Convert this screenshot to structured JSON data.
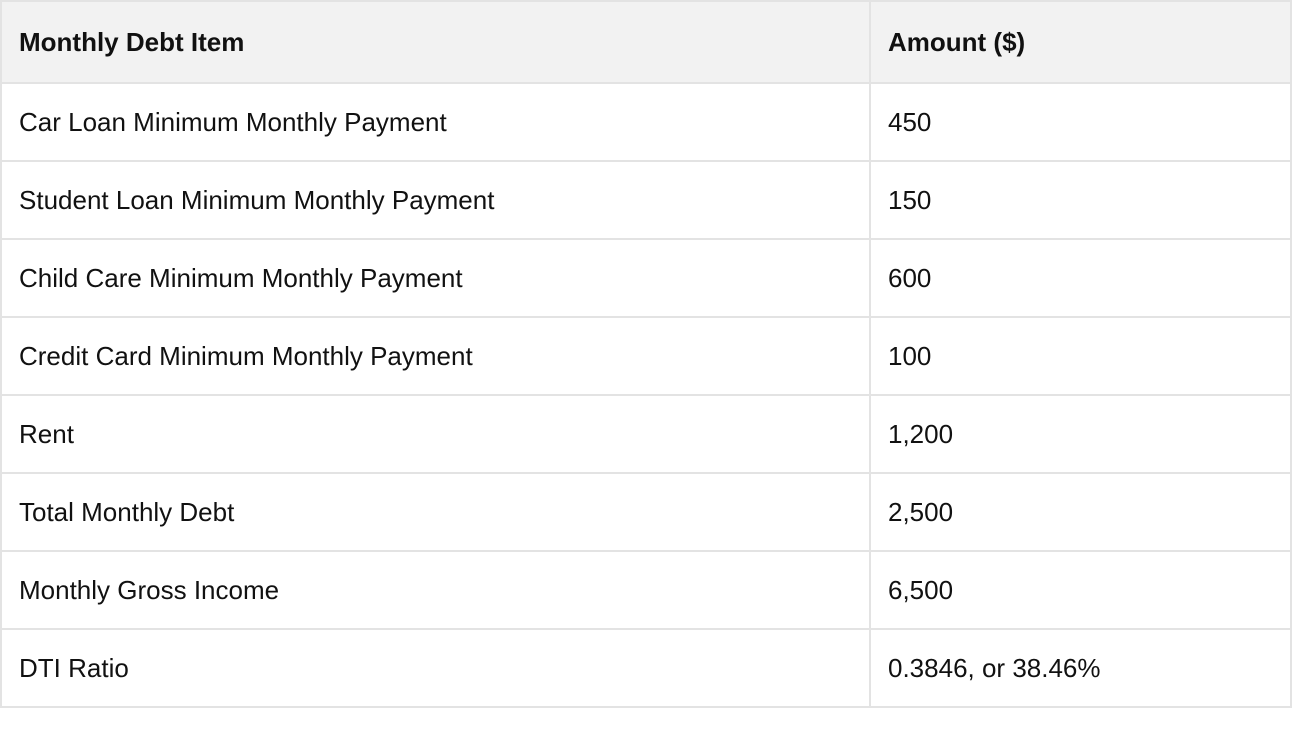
{
  "table": {
    "headers": [
      "Monthly Debt Item",
      "Amount ($)"
    ],
    "rows": [
      [
        "Car Loan Minimum Monthly Payment",
        "450"
      ],
      [
        "Student Loan Minimum Monthly Payment",
        "150"
      ],
      [
        "Child Care Minimum Monthly Payment",
        "600"
      ],
      [
        "Credit Card Minimum Monthly Payment",
        "100"
      ],
      [
        "Rent",
        "1,200"
      ],
      [
        "Total Monthly Debt",
        "2,500"
      ],
      [
        "Monthly Gross Income",
        "6,500"
      ],
      [
        "DTI Ratio",
        "0.3846, or 38.46%"
      ]
    ]
  }
}
